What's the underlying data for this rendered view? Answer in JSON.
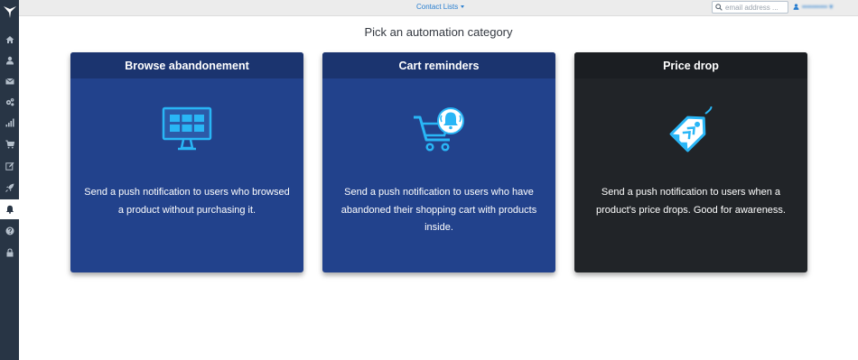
{
  "app": {
    "nav_items": [
      {
        "icon": "home-icon"
      },
      {
        "icon": "user-icon"
      },
      {
        "icon": "envelope-icon"
      },
      {
        "icon": "gears-icon"
      },
      {
        "icon": "signal-icon"
      },
      {
        "icon": "cart-icon"
      },
      {
        "icon": "edit-icon"
      },
      {
        "icon": "rocket-icon"
      },
      {
        "icon": "bell-icon",
        "active": true
      },
      {
        "icon": "question-icon"
      },
      {
        "icon": "lock-icon"
      }
    ]
  },
  "topbar": {
    "contact_lists_label": "Contact Lists",
    "search_placeholder": "email address ...",
    "user_name": "•••••••••• ▾"
  },
  "page": {
    "title": "Pick an automation category"
  },
  "cards": [
    {
      "title": "Browse abandonement",
      "description": "Send a push notification to users who browsed a product without purchasing it.",
      "icon": "monitor-grid-icon"
    },
    {
      "title": "Cart reminders",
      "description": "Send a push notification to users who have abandoned their shopping cart with products inside.",
      "icon": "cart-bell-icon"
    },
    {
      "title": "Price drop",
      "description": "Send a push notification to users when a product's price drops. Good for awareness.",
      "icon": "price-tag-icon"
    }
  ],
  "colors": {
    "sidebar": "#283545",
    "card_blue": "#22428c",
    "card_blue_header": "#1b346f",
    "card_dark": "#212428",
    "icon_accent": "#29b6f6",
    "link": "#2a7fd0"
  }
}
